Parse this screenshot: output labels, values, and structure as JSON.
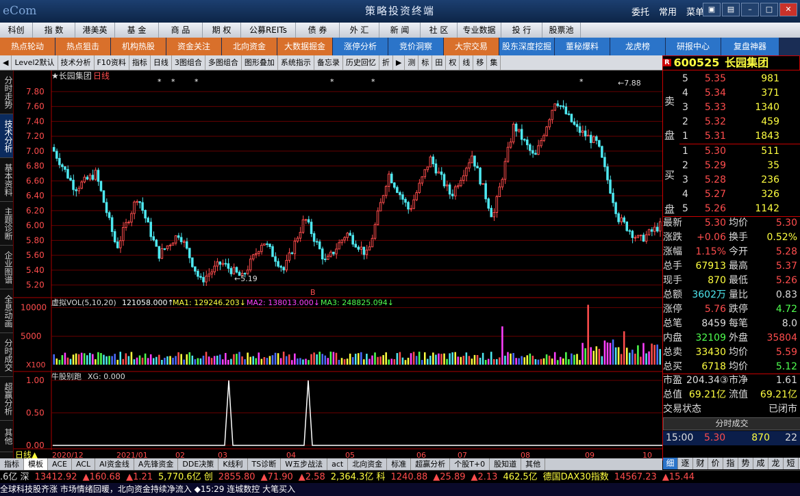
{
  "window": {
    "logo": "eCom",
    "title": "策略投资终端",
    "menu": [
      "委托",
      "常用",
      "菜单"
    ]
  },
  "menubar": [
    "科创板",
    "指 数",
    "港美英",
    "基 金",
    "商 品",
    "期 权",
    "公募REITs",
    "债 券",
    "外 汇",
    "新 闻",
    "社 区",
    "专业数据",
    "投 行",
    "股票池"
  ],
  "bluebar": [
    {
      "label": "热点轮动",
      "c": "or"
    },
    {
      "label": "热点狙击",
      "c": "or"
    },
    {
      "label": "机构热股",
      "c": "or"
    },
    {
      "label": "资金关注",
      "c": "or"
    },
    {
      "label": "北向资金",
      "c": "or"
    },
    {
      "label": "大数据掘金",
      "c": "or"
    },
    {
      "label": "涨停分析",
      "c": "bl"
    },
    {
      "label": "竞价洞察",
      "c": "bl"
    },
    {
      "label": "大宗交易",
      "c": "or"
    },
    {
      "label": "股东深度挖掘",
      "c": "bl"
    },
    {
      "label": "董秘爆料",
      "c": "bl"
    },
    {
      "label": "龙虎榜",
      "c": "bl"
    },
    {
      "label": "研报中心",
      "c": "bl"
    },
    {
      "label": "复盘神器",
      "c": "bl"
    }
  ],
  "toolbar": [
    "Level2默认",
    "技术分析",
    "F10资料",
    "指标",
    "日线",
    "3图组合",
    "多图组合",
    "图形叠加",
    "系统指示",
    "备忘录",
    "历史回忆",
    "折"
  ],
  "toolbar_right": [
    "测",
    "标",
    "田",
    "权",
    "线",
    "移",
    "集"
  ],
  "stock": {
    "code": "600525",
    "name": "长园集团"
  },
  "leftnav": [
    "分时走势",
    "技术分析",
    "基本资料",
    "主题诊断",
    "企业图谱",
    "全息动画",
    "分时成交",
    "超赢分析",
    "其他"
  ],
  "chart": {
    "label": "长园集团",
    "period": "日线",
    "high_mark": "7.88",
    "low_mark": "5.19",
    "yticks": [
      "7.80",
      "7.60",
      "7.40",
      "7.20",
      "7.00",
      "6.80",
      "6.60",
      "6.40",
      "6.20",
      "6.00",
      "5.80",
      "5.60",
      "5.40",
      "5.20"
    ],
    "vol_title": "虚拟VOL(5,10,20)",
    "vol_value": "121058.000↑",
    "ma1": "MA1: 129246.203↓",
    "ma2": "MA2: 138013.000↓",
    "ma3": "MA3: 248825.094↓",
    "vol_ticks": [
      "10000",
      "5000",
      "X100"
    ],
    "ind_title": "牛股别跑",
    "ind_xg": "XG: 0.000",
    "ind_ticks": [
      "1.00",
      "0.50",
      "0.00"
    ],
    "dates": [
      "2020/12",
      "2021/01",
      "02",
      "03",
      "04",
      "05",
      "06",
      "07",
      "08",
      "09",
      "10"
    ],
    "period_label": "日线▲"
  },
  "asks": [
    {
      "l": "5",
      "p": "5.35",
      "v": "981"
    },
    {
      "l": "4",
      "p": "5.34",
      "v": "371"
    },
    {
      "l": "3",
      "p": "5.33",
      "v": "1340"
    },
    {
      "l": "2",
      "p": "5.32",
      "v": "459"
    },
    {
      "l": "1",
      "p": "5.31",
      "v": "1843"
    }
  ],
  "bids": [
    {
      "l": "1",
      "p": "5.30",
      "v": "511"
    },
    {
      "l": "2",
      "p": "5.29",
      "v": "35"
    },
    {
      "l": "3",
      "p": "5.28",
      "v": "236"
    },
    {
      "l": "4",
      "p": "5.27",
      "v": "326"
    },
    {
      "l": "5",
      "p": "5.26",
      "v": "1142"
    }
  ],
  "sell_label": [
    "卖",
    "盘"
  ],
  "buy_label": [
    "买",
    "盘"
  ],
  "quote": [
    [
      "最新",
      "5.30",
      "red",
      "均价",
      "5.30",
      "red"
    ],
    [
      "涨跌",
      "+0.06",
      "red",
      "换手",
      "0.52%",
      "yel"
    ],
    [
      "涨幅",
      "1.15%",
      "red",
      "今开",
      "5.28",
      "red"
    ],
    [
      "总手",
      "67913",
      "yel",
      "最高",
      "5.37",
      "red"
    ],
    [
      "现手",
      "870",
      "yel",
      "最低",
      "5.26",
      "red"
    ],
    [
      "总额",
      "3602万",
      "cyan",
      "量比",
      "0.83",
      "wh"
    ],
    [
      "涨停",
      "5.76",
      "red",
      "跌停",
      "4.72",
      "grn"
    ],
    [
      "总笔",
      "8459",
      "wh",
      "每笔",
      "8.0",
      "wh"
    ],
    [
      "内盘",
      "32109",
      "grn",
      "外盘",
      "35804",
      "red"
    ],
    [
      "总卖",
      "33430",
      "yel",
      "均价",
      "5.59",
      "red"
    ],
    [
      "总买",
      "6718",
      "yel",
      "均价",
      "5.12",
      "grn"
    ]
  ],
  "quote2": [
    [
      "市盈",
      "204.34③",
      "wh",
      "市净",
      "1.61",
      "wh"
    ],
    [
      "总值",
      "69.21亿",
      "yel",
      "流值",
      "69.21亿",
      "yel"
    ]
  ],
  "trade_status": [
    "交易状态",
    "已闭市"
  ],
  "trades_title": "分时成交",
  "trades_tab": "细",
  "trade": {
    "t": "15:00",
    "p": "5.30",
    "v": "870",
    "n": "22"
  },
  "panel_tabs": [
    "细",
    "逐",
    "财",
    "价",
    "指",
    "势",
    "成",
    "龙",
    "短"
  ],
  "bottomtabs": [
    "指标",
    "模板",
    "ACE",
    "ACL",
    "AI资金线",
    "A先锋资金",
    "DDE决策",
    "K线利",
    "TS诊断",
    "W五步战法",
    "act",
    "北向资金",
    "标准",
    "超赢分析",
    "个股T+0",
    "股知道",
    "其他"
  ],
  "ticker": [
    {
      "t": ".6亿 深",
      "c": "wh"
    },
    {
      "t": "13412.92",
      "c": "red"
    },
    {
      "t": "▲160.68",
      "c": "red"
    },
    {
      "t": "▲1.21",
      "c": "red"
    },
    {
      "t": "5,770.6亿 创",
      "c": "yel"
    },
    {
      "t": "2855.80",
      "c": "red"
    },
    {
      "t": "▲71.90",
      "c": "red"
    },
    {
      "t": "▲2.58",
      "c": "red"
    },
    {
      "t": "2,364.3亿 科",
      "c": "yel"
    },
    {
      "t": "1240.88",
      "c": "red"
    },
    {
      "t": "▲25.89",
      "c": "red"
    },
    {
      "t": "▲2.13",
      "c": "red"
    },
    {
      "t": "462.5亿",
      "c": "yel"
    },
    {
      "t": "德国DAX30指数",
      "c": "yel"
    },
    {
      "t": "14567.23",
      "c": "red"
    },
    {
      "t": "▲15.44",
      "c": "red"
    }
  ],
  "news": "全球科技股齐涨 市场情绪回暖，北向资金持续净流入 ◆15:29 连城数控 大笔买入"
}
